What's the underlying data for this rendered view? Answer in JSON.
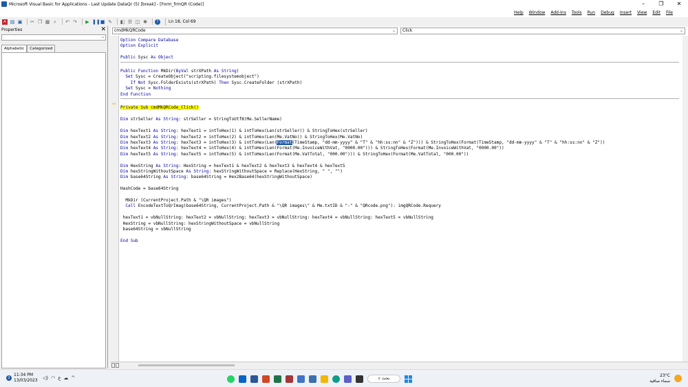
{
  "window": {
    "title": "Microsoft Visual Basic for Applications - Last Update DataQr (5) [break] - [Form_frmQR (Code)]",
    "minimize": "–",
    "maximize": "❐",
    "close": "✕"
  },
  "menubar": {
    "items": [
      "Help",
      "Window",
      "Add-Ins",
      "Tools",
      "Run",
      "Debug",
      "Insert",
      "View",
      "Edit",
      "File"
    ]
  },
  "toolbar": {
    "status": "Ln 18, Col 69"
  },
  "properties": {
    "title": "Properties",
    "close": "✕",
    "tab_alphabetic": "Alphabetic",
    "tab_categorized": "Categorized"
  },
  "code_window": {
    "object_combo": "cmdMkQRCode",
    "proc_combo": "Click"
  },
  "code_lines": [
    "Option Compare Database",
    "Option Explicit",
    "",
    "Public Sysc As Object",
    "",
    "Public Function MkDir(ByVal strXPath As String)",
    "  Set Sysc = CreateObject(\"scripting.filesystemobject\")",
    "    If Not Sysc.FolderExists(strXPath) Then Sysc.CreateFolder (strXPath)",
    "  Set Sysc = Nothing",
    "End Function",
    "",
    "Private Sub cmdMkQRCode_Click()",
    "",
    "Dim strSeller As String: strSeller = StringToUtf8(Me.SellerName)",
    "",
    "Dim hexText1 As String: hexText1 = intToHex(1) & intToHex(Len(strSeller)) & StringToHex(strSeller)",
    "Dim hexText2 As String: hexText2 = intToHex(2) & intToHex(Len(Me.VatNo)) & StringToHex(Me.VatNo)",
    "Dim hexText3 As String: hexText3 = intToHex(3) & intToHex(Len(Format(TimeStamp, \"dd-mm-yyyy\" & \"T\" & \"hh:ss:nn\" & \"Z\"))) & StringToHex(Format(TimeStamp, \"dd-mm-yyyy\" & \"T\" & \"hh:ss:nn\" & \"Z\"))",
    "Dim hexText4 As String: hexText4 = intToHex(4) & intToHex(Len(Format(Me.InvoiceWithVat, \"0000.00\"))) & StringToHex(Format(Me.InvoiceWithVat, \"0000.00\"))",
    "Dim hexText5 As String: hexText5 = intToHex(5) & intToHex(Len(Format(Me.VatTotal, \"000.00\"))) & StringToHex(Format(Me.VatTotal, \"000.00\"))",
    "",
    "Dim HexString As String: HexString = hexText1 & hexText2 & hexText3 & hexText4 & hexText5",
    "Dim hexStringWithoutSpace As String: hexStringWithoutSpace = Replace(HexString, \" \", \"\")",
    "Dim base64String As String: base64String = Hex2Base64(hexStringWithoutSpace)",
    "",
    "HashCode = base64String",
    "",
    "  MkDir (CurrentProject.Path & \"\\QR images\")",
    "  Call EncodeTextToQrImag(base64String, CurrentProject.Path & \"\\QR images\\\" & Me.txtID & \"-\" & \"QRcode.png\"): imgQRCode.Requery",
    "",
    " hexText1 = vbNullString: hexText2 = vbNullString: hexText3 = vbNullString: hexText4 = vbNullString: hexText5 = vbNullString",
    " HexString = vbNullString: hexStringWithoutSpace = vbNullString",
    " base64String = vbNullString",
    "",
    "End Sub"
  ],
  "taskbar": {
    "time": "11:34 PM",
    "date": "13/03/2023",
    "lang": "ع",
    "search": "بحث",
    "temp": "23°C",
    "weather": "سماء صافية"
  },
  "colors": {
    "keyword": "#0000a0",
    "highlight": "#ffff00",
    "selection": "#1e5aa8"
  }
}
